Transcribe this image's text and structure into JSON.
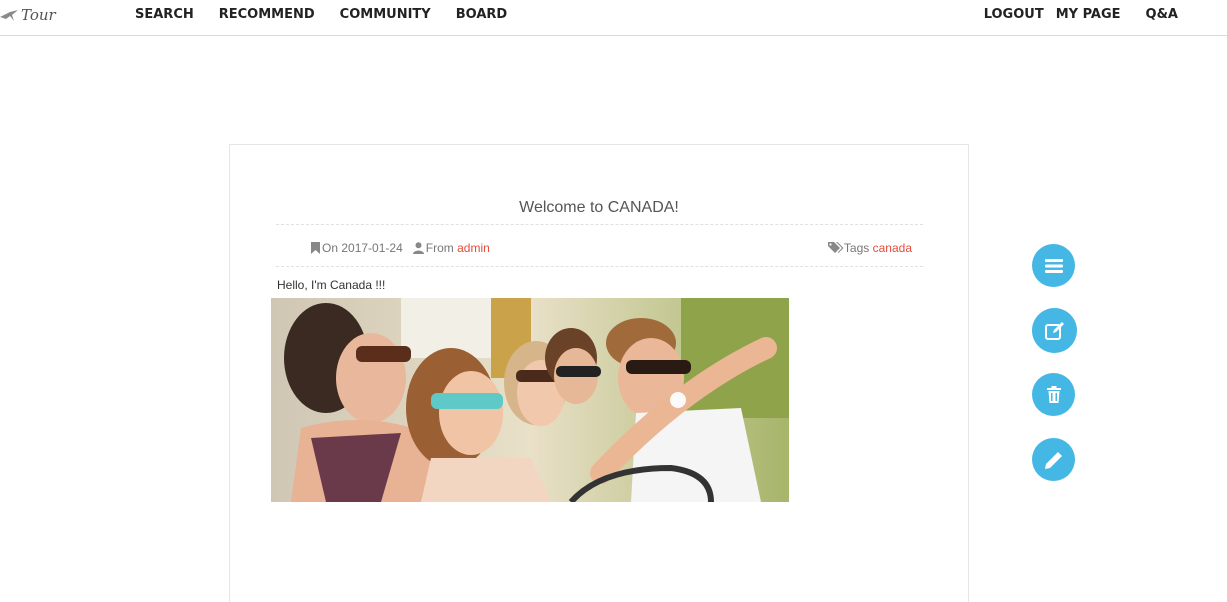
{
  "brand": {
    "name": "Tour"
  },
  "nav": {
    "left": [
      "SEARCH",
      "RECOMMEND",
      "COMMUNITY",
      "BOARD"
    ],
    "right": [
      "LOGOUT",
      "MY PAGE",
      "Q&A"
    ]
  },
  "post": {
    "title": "Welcome to CANADA!",
    "date_prefix": "On",
    "date": "2017-01-24",
    "author_prefix": "From",
    "author": "admin",
    "tags_prefix": "Tags",
    "tag": "canada",
    "body": "Hello, I'm Canada !!!",
    "image_icon": "photo-of-friends"
  },
  "actions": {
    "icons": [
      "list-icon",
      "edit-icon",
      "trash-icon",
      "pencil-icon"
    ],
    "color": "#45b7e5"
  },
  "colors": {
    "link": "#e74c3c"
  }
}
